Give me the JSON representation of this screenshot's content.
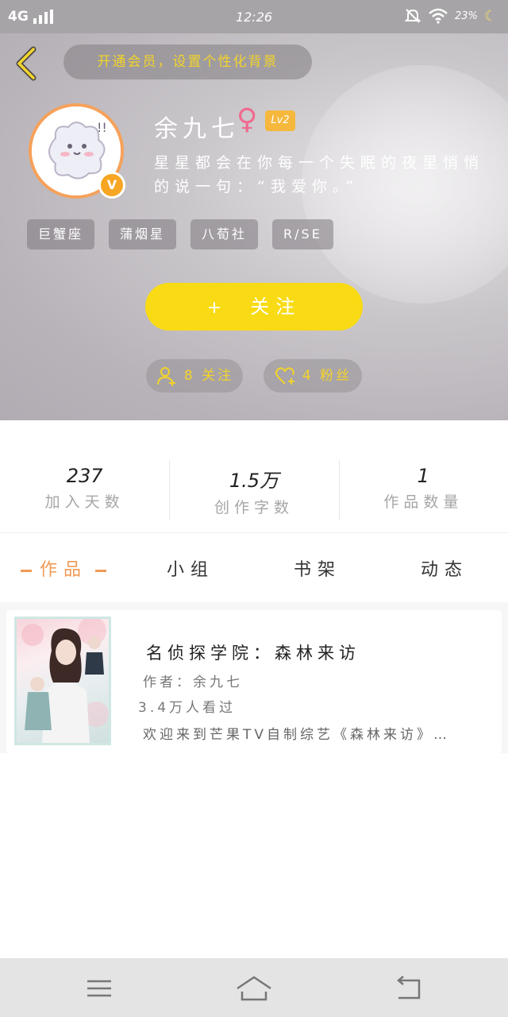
{
  "status_bar": {
    "network": "4G",
    "time": "12:26",
    "battery": "23%"
  },
  "header": {
    "bg_hint": "开通会员，设置个性化背景",
    "nickname": "余九七",
    "gender_symbol": "♀",
    "level": "Lv2",
    "verified_badge": "V",
    "bio": "星星都会在你每一个失眠的夜里悄悄的说一句：“我爱你。”",
    "tags": [
      "巨蟹座",
      "蒲烟星",
      "八荀社",
      "R/SE"
    ],
    "follow_plus": "+",
    "follow_label": "关注",
    "following_count": "8 关注",
    "fans_count": "4 粉丝"
  },
  "stats": [
    {
      "value": "237",
      "label": "加入天数"
    },
    {
      "value": "1.5万",
      "label": "创作字数"
    },
    {
      "value": "1",
      "label": "作品数量"
    }
  ],
  "tabs": [
    {
      "label": "作品",
      "active": true
    },
    {
      "label": "小组",
      "active": false
    },
    {
      "label": "书架",
      "active": false
    },
    {
      "label": "动态",
      "active": false
    }
  ],
  "works": [
    {
      "title": "名侦探学院：森林来访",
      "author": "作者：余九七",
      "views": "3.4万人看过",
      "description": "欢迎来到芒果TV自制综艺《森林来访》…"
    }
  ],
  "icons": {
    "back": "chevron-left-icon",
    "gender": "female-icon",
    "following": "person-add-icon",
    "fans": "heart-add-icon",
    "menu": "menu-icon",
    "home": "home-icon",
    "return": "return-icon"
  },
  "colors": {
    "accent_yellow": "#f8db14",
    "accent_orange": "#f09a55",
    "hint_text": "#f3d32a",
    "gender_pink": "#f06a8e",
    "level_badge": "#f5b83d"
  }
}
